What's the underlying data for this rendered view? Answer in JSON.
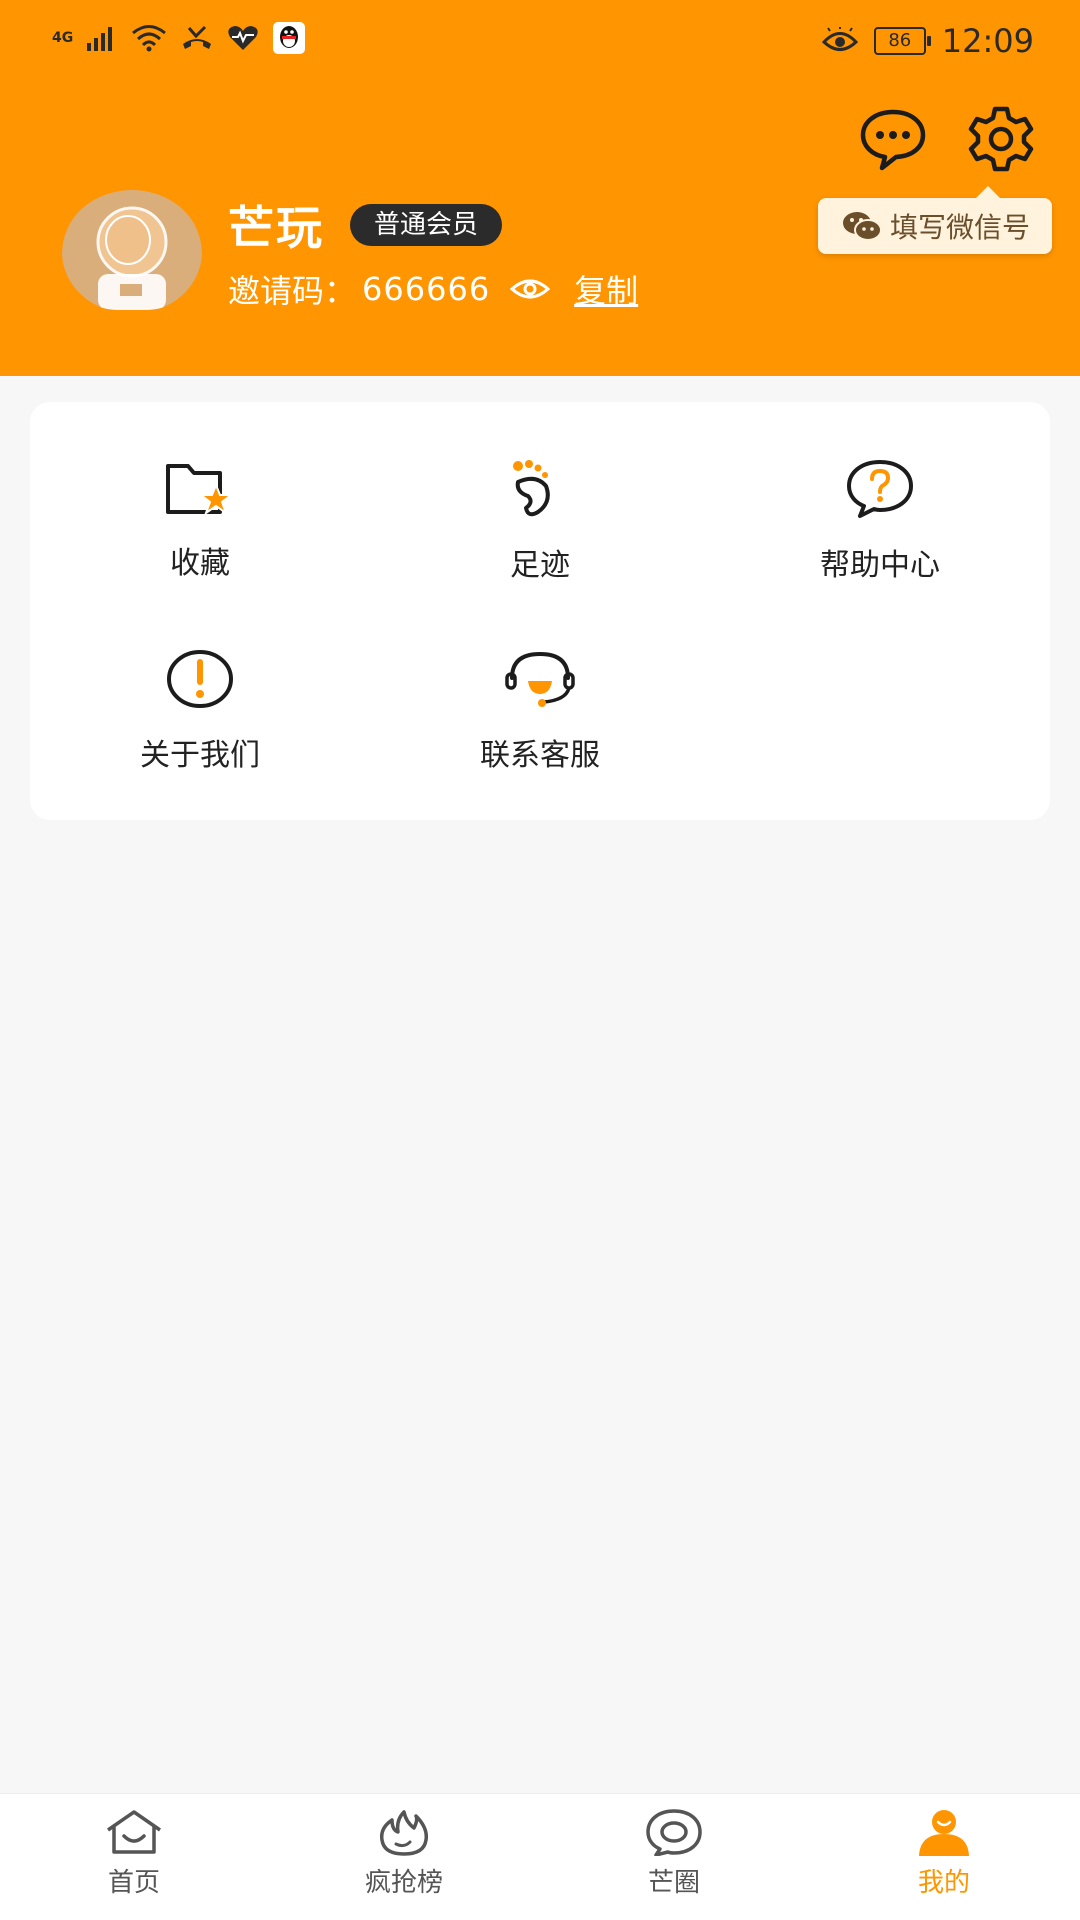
{
  "status_bar": {
    "network": "4G",
    "battery": "86",
    "time": "12:09"
  },
  "profile": {
    "name": "芒玩",
    "membership": "普通会员",
    "invite_label": "邀请码：",
    "invite_code": "666666",
    "copy_label": "复制"
  },
  "tooltip": {
    "text": "填写微信号"
  },
  "menu": {
    "items": [
      {
        "label": "收藏",
        "icon": "favorite-folder-icon"
      },
      {
        "label": "足迹",
        "icon": "footprint-icon"
      },
      {
        "label": "帮助中心",
        "icon": "help-center-icon"
      },
      {
        "label": "关于我们",
        "icon": "about-us-icon"
      },
      {
        "label": "联系客服",
        "icon": "customer-service-icon"
      }
    ]
  },
  "tabbar": {
    "tabs": [
      {
        "label": "首页",
        "icon": "home-icon"
      },
      {
        "label": "疯抢榜",
        "icon": "fire-icon"
      },
      {
        "label": "芒圈",
        "icon": "circle-chat-icon"
      },
      {
        "label": "我的",
        "icon": "profile-icon",
        "active": true
      }
    ]
  },
  "colors": {
    "accent": "#FF9500",
    "badge_bg": "#2b2b2b",
    "tooltip_bg": "#FFF3DE"
  }
}
